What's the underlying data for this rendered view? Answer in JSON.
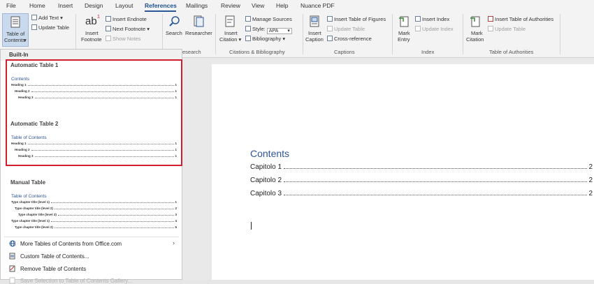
{
  "ribbon_tabs": [
    "File",
    "Home",
    "Insert",
    "Design",
    "Layout",
    "References",
    "Mailings",
    "Review",
    "View",
    "Help",
    "Nuance PDF"
  ],
  "active_tab": "References",
  "ribbon": {
    "toc_button": "Table of Contents",
    "toc_line1": "Table of",
    "toc_line2": "Contents",
    "add_text": "Add Text",
    "update_table": "Update Table",
    "insert_footnote_line1": "Insert",
    "insert_footnote_line2": "Footnote",
    "insert_endnote": "Insert Endnote",
    "next_footnote": "Next Footnote",
    "show_notes": "Show Notes",
    "search": "Search",
    "researcher": "Researcher",
    "research_group": "esearch",
    "insert_citation_line1": "Insert",
    "insert_citation_line2": "Citation",
    "manage_sources": "Manage Sources",
    "style_label": "Style:",
    "style_value": "APA",
    "bibliography": "Bibliography",
    "citations_group": "Citations & Bibliography",
    "insert_caption_line1": "Insert",
    "insert_caption_line2": "Caption",
    "insert_table_of_figures": "Insert Table of Figures",
    "update_table_captions": "Update Table",
    "cross_reference": "Cross-reference",
    "captions_group": "Captions",
    "mark_entry_line1": "Mark",
    "mark_entry_line2": "Entry",
    "insert_index": "Insert Index",
    "update_index": "Update Index",
    "index_group": "Index",
    "mark_citation_line1": "Mark",
    "mark_citation_line2": "Citation",
    "insert_table_of_authorities": "Insert Table of Authorities",
    "update_table_authorities": "Update Table",
    "authorities_group": "Table of Authorities"
  },
  "toc_menu": {
    "header": "Built-In",
    "auto1": {
      "title": "Automatic Table 1",
      "preview_heading": "Contents",
      "lines": [
        {
          "text": "Heading 1",
          "page": "1"
        },
        {
          "text": "Heading 2",
          "page": "1"
        },
        {
          "text": "Heading 3",
          "page": "1"
        }
      ]
    },
    "auto2": {
      "title": "Automatic Table 2",
      "preview_heading": "Table of Contents",
      "lines": [
        {
          "text": "Heading 1",
          "page": "1"
        },
        {
          "text": "Heading 2",
          "page": "1"
        },
        {
          "text": "Heading 3",
          "page": "1"
        }
      ]
    },
    "manual": {
      "title": "Manual Table",
      "preview_heading": "Table of Contents",
      "lines": [
        {
          "text": "Type chapter title (level 1)",
          "page": "1"
        },
        {
          "text": "Type chapter title (level 2)",
          "page": "2"
        },
        {
          "text": "Type chapter title (level 3)",
          "page": "3"
        },
        {
          "text": "Type chapter title (level 1)",
          "page": "4"
        },
        {
          "text": "Type chapter title (level 2)",
          "page": "5"
        }
      ]
    },
    "more_tables": "More Tables of Contents from Office.com",
    "custom_toc": "Custom Table of Contents...",
    "remove_toc": "Remove Table of Contents",
    "save_selection": "Save Selection to Table of Contents Gallery..."
  },
  "document": {
    "title": "Contents",
    "entries": [
      {
        "text": "Capitolo 1",
        "page": "2"
      },
      {
        "text": "Capitolo 2",
        "page": "2"
      },
      {
        "text": "Capitolo 3",
        "page": "2"
      }
    ]
  },
  "colors": {
    "accent": "#2f5597",
    "highlight": "#d02030"
  }
}
